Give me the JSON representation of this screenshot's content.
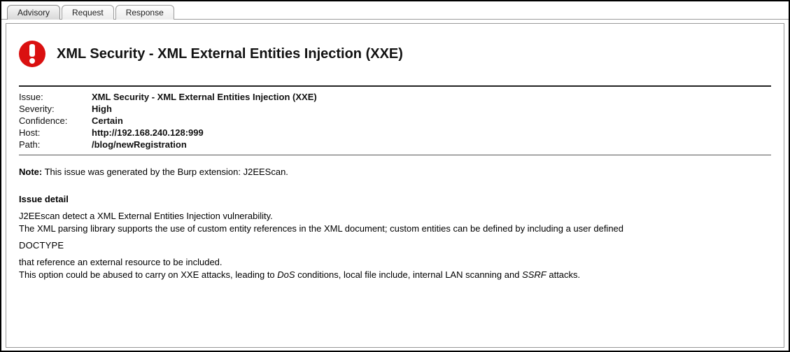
{
  "tabs": {
    "advisory": "Advisory",
    "request": "Request",
    "response": "Response"
  },
  "title": "XML Security - XML External Entities Injection (XXE)",
  "kv": {
    "issue_label": "Issue:",
    "issue_value": "XML Security - XML External Entities Injection (XXE)",
    "severity_label": "Severity:",
    "severity_value": "High",
    "confidence_label": "Confidence:",
    "confidence_value": "Certain",
    "host_label": "Host:",
    "host_value": "http://192.168.240.128:999",
    "path_label": "Path:",
    "path_value": "/blog/newRegistration"
  },
  "note": {
    "label": "Note:",
    "text": " This issue was generated by the Burp extension: J2EEScan."
  },
  "detail": {
    "heading": "Issue detail",
    "p1": "J2EEscan detect a XML External Entities Injection vulnerability.",
    "p2": "The XML parsing library supports the use of custom entity references in the XML document; custom entities can be defined by including a user defined",
    "doctype": "DOCTYPE",
    "p3": "that reference an external resource to be included.",
    "p4_pre": "This option could be abused to carry on XXE attacks, leading to ",
    "p4_dos": "DoS",
    "p4_mid": " conditions, local file include, internal LAN scanning and ",
    "p4_ssrf": "SSRF",
    "p4_post": " attacks."
  }
}
